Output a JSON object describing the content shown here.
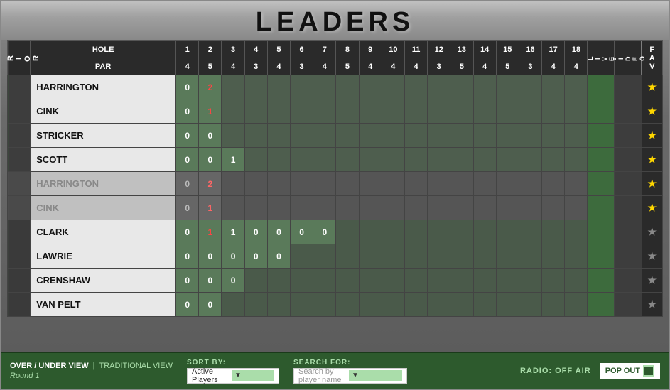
{
  "title": "LEADERS",
  "header": {
    "prior_label": "PRIOR",
    "hole_label": "HOLE",
    "par_label": "PAR",
    "live_label": "LIVE",
    "video_label": "VIDEO",
    "fav_label": "FAV"
  },
  "holes": [
    "1",
    "2",
    "3",
    "4",
    "5",
    "6",
    "7",
    "8",
    "9",
    "10",
    "11",
    "12",
    "13",
    "14",
    "15",
    "16",
    "17",
    "18"
  ],
  "par": [
    "4",
    "5",
    "4",
    "3",
    "4",
    "3",
    "4",
    "5",
    "4",
    "4",
    "4",
    "3",
    "5",
    "4",
    "5",
    "3",
    "4",
    "4"
  ],
  "players": [
    {
      "name": "HARRINGTON",
      "prior": "",
      "scores": [
        "0",
        "2",
        "",
        "",
        "",
        "",
        "",
        "",
        "",
        "",
        "",
        "",
        "",
        "",
        "",
        "",
        "",
        ""
      ],
      "live": "",
      "video": "",
      "fav": "gold",
      "style": "active",
      "score_colors": [
        "white",
        "red",
        "",
        "",
        "",
        "",
        "",
        "",
        "",
        "",
        "",
        "",
        "",
        "",
        "",
        "",
        "",
        ""
      ]
    },
    {
      "name": "CINK",
      "prior": "",
      "scores": [
        "0",
        "1",
        "",
        "",
        "",
        "",
        "",
        "",
        "",
        "",
        "",
        "",
        "",
        "",
        "",
        "",
        "",
        ""
      ],
      "live": "",
      "video": "",
      "fav": "gold",
      "style": "active",
      "score_colors": [
        "white",
        "red",
        "",
        "",
        "",
        "",
        "",
        "",
        "",
        "",
        "",
        "",
        "",
        "",
        "",
        "",
        "",
        ""
      ]
    },
    {
      "name": "STRICKER",
      "prior": "",
      "scores": [
        "0",
        "0",
        "",
        "",
        "",
        "",
        "",
        "",
        "",
        "",
        "",
        "",
        "",
        "",
        "",
        "",
        "",
        ""
      ],
      "live": "",
      "video": "",
      "fav": "gold",
      "style": "active",
      "score_colors": [
        "white",
        "white",
        "",
        "",
        "",
        "",
        "",
        "",
        "",
        "",
        "",
        "",
        "",
        "",
        "",
        "",
        "",
        ""
      ]
    },
    {
      "name": "SCOTT",
      "prior": "",
      "scores": [
        "0",
        "0",
        "1",
        "",
        "",
        "",
        "",
        "",
        "",
        "",
        "",
        "",
        "",
        "",
        "",
        "",
        "",
        ""
      ],
      "live": "",
      "video": "",
      "fav": "gold",
      "style": "active",
      "score_colors": [
        "white",
        "white",
        "white",
        "",
        "",
        "",
        "",
        "",
        "",
        "",
        "",
        "",
        "",
        "",
        "",
        "",
        "",
        ""
      ]
    },
    {
      "name": "HARRINGTON",
      "prior": "",
      "scores": [
        "0",
        "2",
        "",
        "",
        "",
        "",
        "",
        "",
        "",
        "",
        "",
        "",
        "",
        "",
        "",
        "",
        "",
        ""
      ],
      "live": "",
      "video": "",
      "fav": "gold",
      "style": "grayed",
      "score_colors": [
        "white",
        "red",
        "",
        "",
        "",
        "",
        "",
        "",
        "",
        "",
        "",
        "",
        "",
        "",
        "",
        "",
        "",
        ""
      ]
    },
    {
      "name": "CINK",
      "prior": "",
      "scores": [
        "0",
        "1",
        "",
        "",
        "",
        "",
        "",
        "",
        "",
        "",
        "",
        "",
        "",
        "",
        "",
        "",
        "",
        ""
      ],
      "live": "",
      "video": "",
      "fav": "gold",
      "style": "grayed",
      "score_colors": [
        "white",
        "red",
        "",
        "",
        "",
        "",
        "",
        "",
        "",
        "",
        "",
        "",
        "",
        "",
        "",
        "",
        "",
        ""
      ]
    },
    {
      "name": "CLARK",
      "prior": "",
      "scores": [
        "0",
        "1",
        "1",
        "0",
        "0",
        "0",
        "0",
        "",
        "",
        "",
        "",
        "",
        "",
        "",
        "",
        "",
        "",
        ""
      ],
      "live": "",
      "video": "",
      "fav": "gray",
      "style": "normal",
      "score_colors": [
        "white",
        "red",
        "white",
        "white",
        "white",
        "white",
        "white",
        "",
        "",
        "",
        "",
        "",
        "",
        "",
        "",
        "",
        "",
        ""
      ]
    },
    {
      "name": "LAWRIE",
      "prior": "",
      "scores": [
        "0",
        "0",
        "0",
        "0",
        "0",
        "",
        "",
        "",
        "",
        "",
        "",
        "",
        "",
        "",
        "",
        "",
        "",
        ""
      ],
      "live": "",
      "video": "",
      "fav": "gray",
      "style": "normal",
      "score_colors": [
        "white",
        "white",
        "white",
        "white",
        "white",
        "",
        "",
        "",
        "",
        "",
        "",
        "",
        "",
        "",
        "",
        "",
        "",
        ""
      ]
    },
    {
      "name": "CRENSHAW",
      "prior": "",
      "scores": [
        "0",
        "0",
        "0",
        "",
        "",
        "",
        "",
        "",
        "",
        "",
        "",
        "",
        "",
        "",
        "",
        "",
        "",
        ""
      ],
      "live": "",
      "video": "",
      "fav": "gray",
      "style": "normal",
      "score_colors": [
        "white",
        "white",
        "white",
        "",
        "",
        "",
        "",
        "",
        "",
        "",
        "",
        "",
        "",
        "",
        "",
        "",
        "",
        ""
      ]
    },
    {
      "name": "VAN PELT",
      "prior": "",
      "scores": [
        "0",
        "0",
        "",
        "",
        "",
        "",
        "",
        "",
        "",
        "",
        "",
        "",
        "",
        "",
        "",
        "",
        "",
        ""
      ],
      "live": "",
      "video": "",
      "fav": "gray",
      "style": "normal",
      "score_colors": [
        "white",
        "white",
        "",
        "",
        "",
        "",
        "",
        "",
        "",
        "",
        "",
        "",
        "",
        "",
        "",
        "",
        "",
        ""
      ]
    }
  ],
  "bottom_bar": {
    "over_under_label": "OVER / UNDER VIEW",
    "separator": "|",
    "traditional_label": "TRADITIONAL VIEW",
    "round_label": "Round 1",
    "sort_label": "SORT BY:",
    "sort_value": "Active Players",
    "search_label": "SEARCH FOR:",
    "search_placeholder": "Search by player name",
    "radio_label": "RADIO: OFF AIR",
    "pop_out_label": "POP OUT"
  }
}
